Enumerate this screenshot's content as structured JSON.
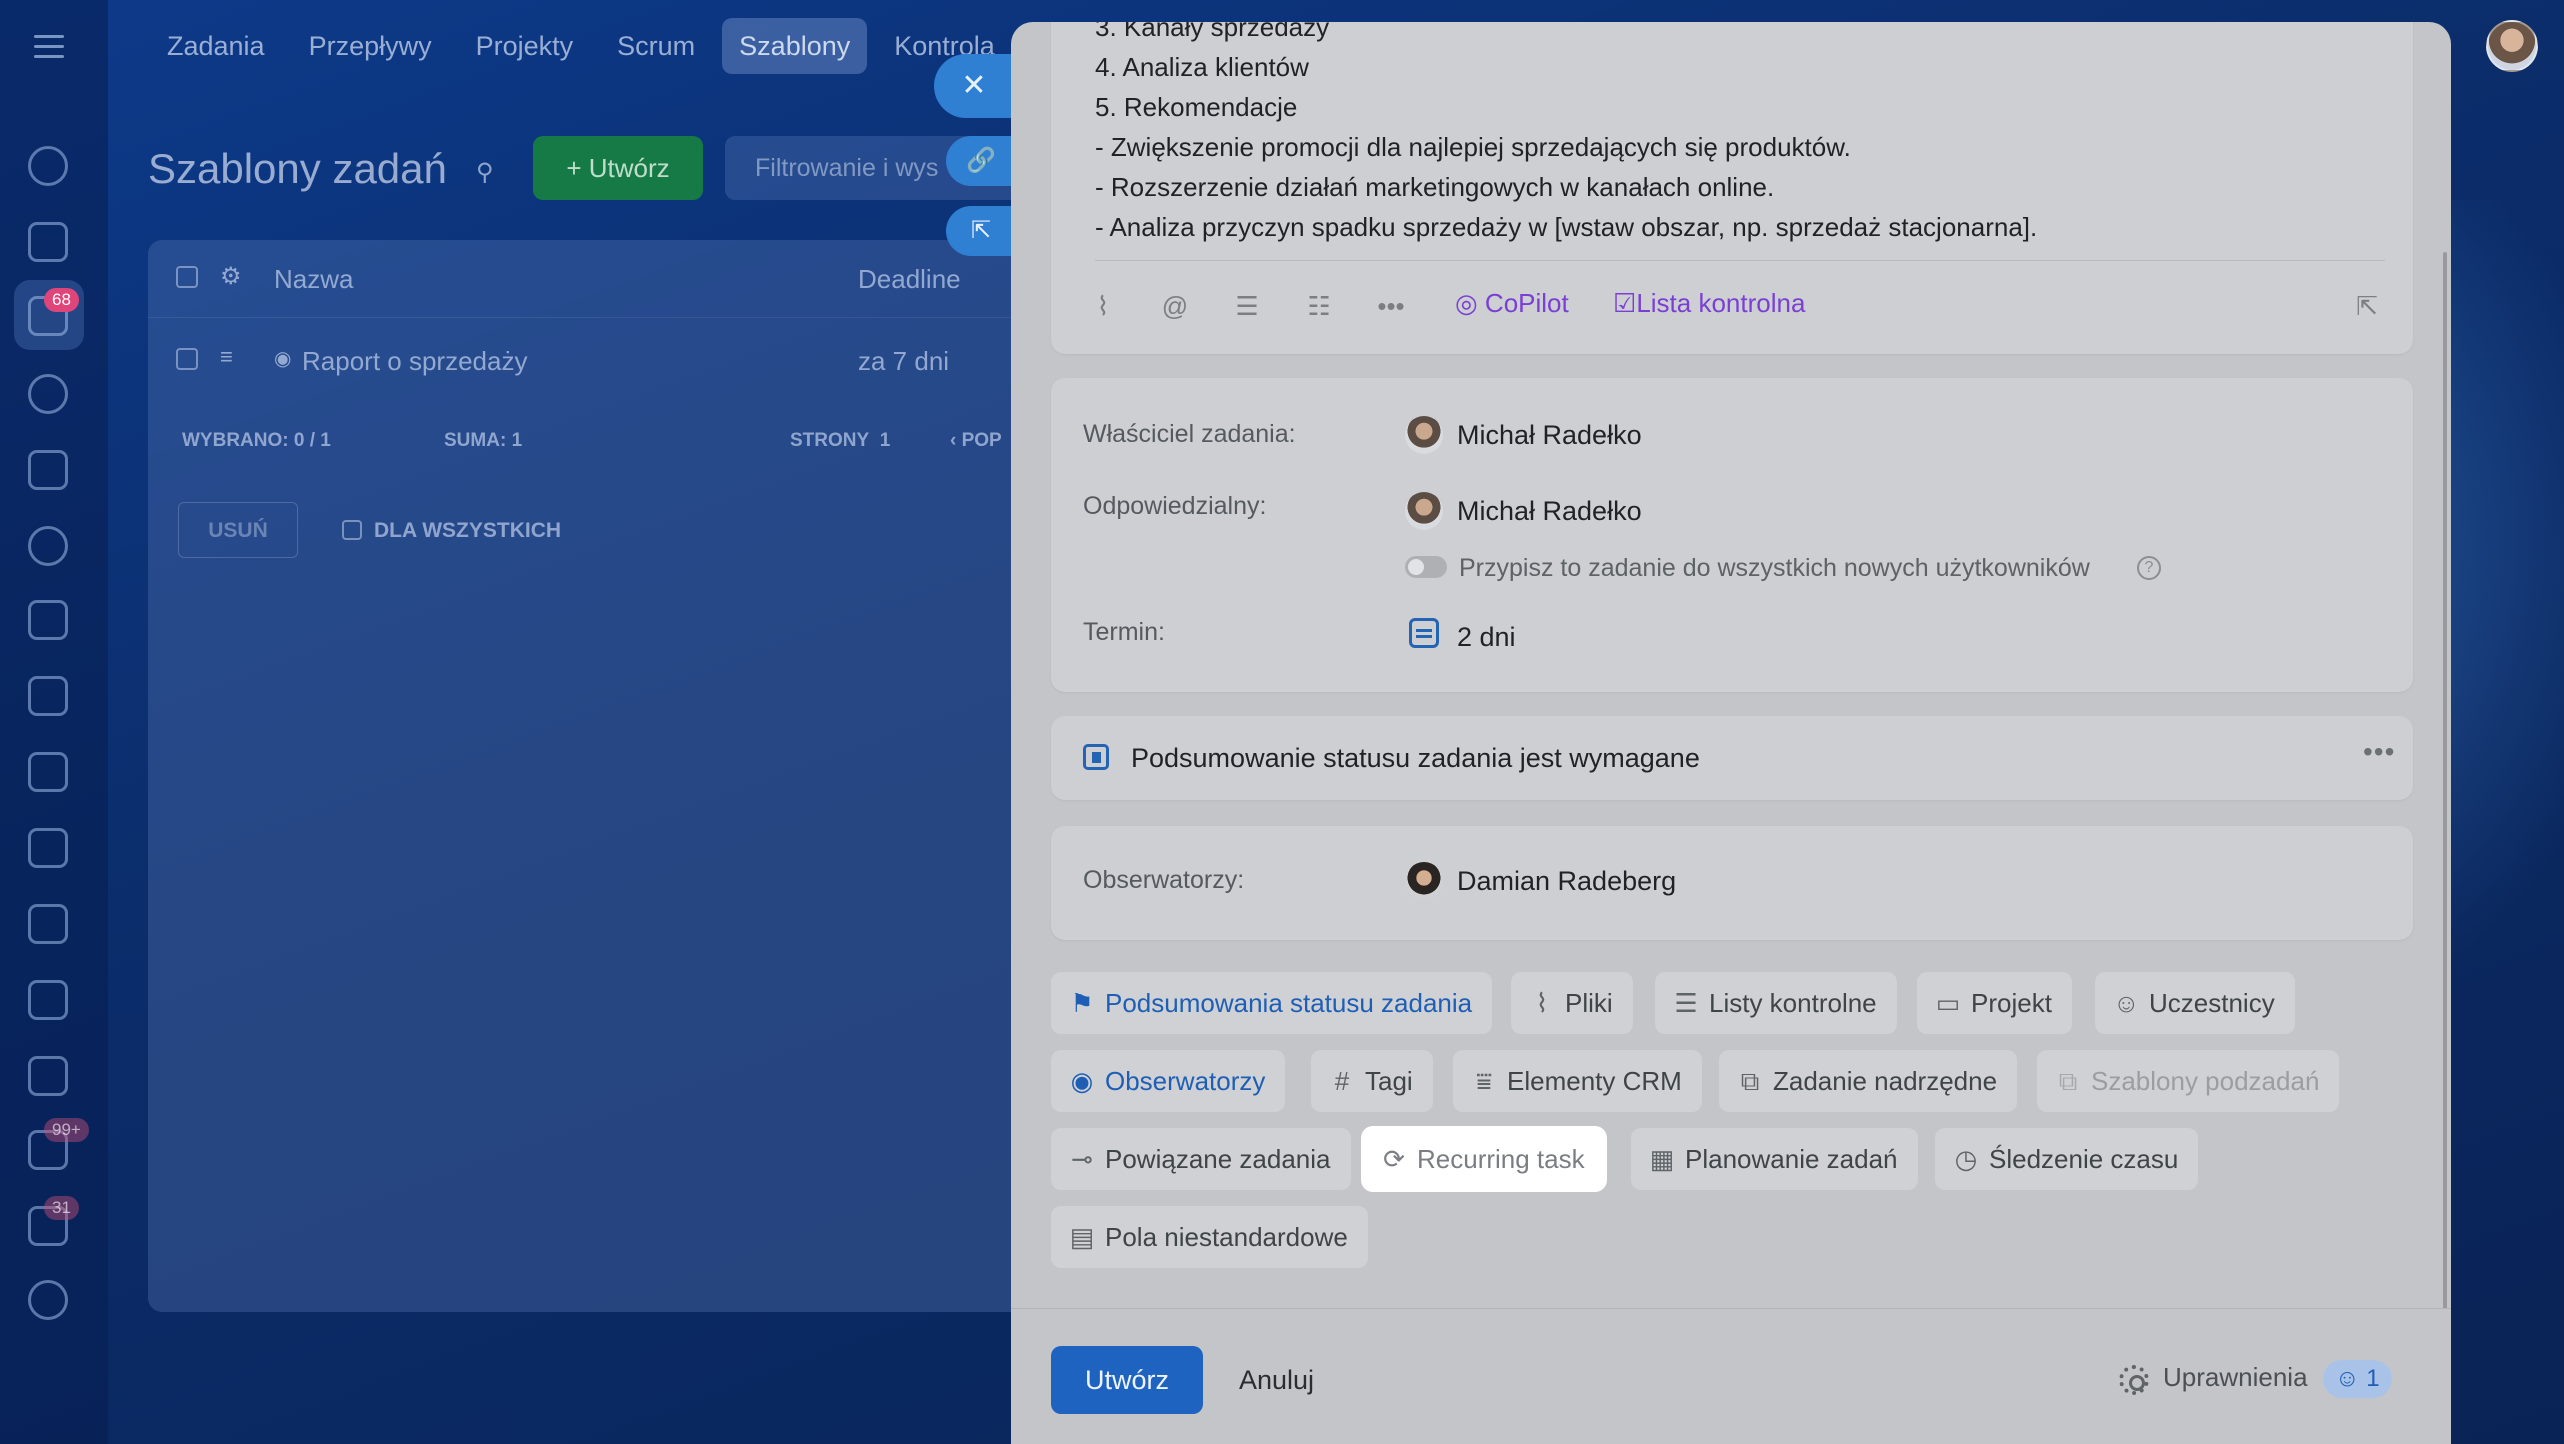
{
  "topnav": {
    "items": [
      "Zadania",
      "Przepływy",
      "Projekty",
      "Scrum",
      "Szablony",
      "Kontrola"
    ],
    "active_index": 4
  },
  "rail": {
    "badge_messages": "68",
    "badge_mail": "99+",
    "badge_other": "31"
  },
  "page": {
    "title": "Szablony zadań",
    "create_label": "+ Utwórz",
    "filter_placeholder": "Filtrowanie i wys"
  },
  "grid": {
    "columns": [
      "Nazwa",
      "Deadline"
    ],
    "rows": [
      {
        "name": "Raport o sprzedaży",
        "deadline": "za 7 dni"
      }
    ],
    "footer": {
      "selected_label": "WYBRANO:",
      "selected_value": "0 / 1",
      "sum_label": "SUMA:",
      "sum_value": "1",
      "pages_label": "STRONY",
      "pages_value": "1",
      "prev_label": "POP"
    },
    "delete_label": "USUŃ",
    "for_all_label": "DLA WSZYSTKICH"
  },
  "panel": {
    "description_lines": [
      "3. Kanały sprzedaży",
      "4. Analiza klientów",
      "5. Rekomendacje",
      "- Zwiększenie promocji dla najlepiej sprzedających się produktów.",
      "- Rozszerzenie działań marketingowych w kanałach online.",
      "- Analiza przyczyn spadku sprzedaży w [wstaw obszar, np. sprzedaż stacjonarna]."
    ],
    "toolbar": {
      "copilot_label": "CoPilot",
      "checklist_label": "Lista kontrolna"
    },
    "owner_label": "Właściciel zadania:",
    "owner_name": "Michał Radełko",
    "responsible_label": "Odpowiedzialny:",
    "responsible_name": "Michał Radełko",
    "assign_all_label": "Przypisz to zadanie do wszystkich nowych użytkowników",
    "term_label": "Termin:",
    "term_value": "2 dni",
    "summary_required_label": "Podsumowanie statusu zadania jest wymagane",
    "observers_label": "Obserwatorzy:",
    "observer_name": "Damian Radeberg",
    "chips": [
      {
        "label": "Podsumowania statusu zadania",
        "icon": "flag-icon",
        "state": "active"
      },
      {
        "label": "Pliki",
        "icon": "paperclip-icon",
        "state": "normal"
      },
      {
        "label": "Listy kontrolne",
        "icon": "checklist-icon",
        "state": "normal"
      },
      {
        "label": "Projekt",
        "icon": "folder-icon",
        "state": "normal"
      },
      {
        "label": "Uczestnicy",
        "icon": "person-icon",
        "state": "normal"
      },
      {
        "label": "Obserwatorzy",
        "icon": "eye-icon",
        "state": "active"
      },
      {
        "label": "Tagi",
        "icon": "hash-icon",
        "state": "normal"
      },
      {
        "label": "Elementy CRM",
        "icon": "crm-icon",
        "state": "normal"
      },
      {
        "label": "Zadanie nadrzędne",
        "icon": "parent-task-icon",
        "state": "normal"
      },
      {
        "label": "Szablony podzadań",
        "icon": "subtask-template-icon",
        "state": "disabled"
      },
      {
        "label": "Powiązane zadania",
        "icon": "link-icon",
        "state": "normal"
      },
      {
        "label": "Recurring task",
        "icon": "repeat-icon",
        "state": "highlighted"
      },
      {
        "label": "Planowanie zadań",
        "icon": "calendar-clock-icon",
        "state": "normal"
      },
      {
        "label": "Śledzenie czasu",
        "icon": "stopwatch-icon",
        "state": "normal"
      },
      {
        "label": "Pola niestandardowe",
        "icon": "custom-fields-icon",
        "state": "normal"
      }
    ],
    "footer": {
      "create_label": "Utwórz",
      "cancel_label": "Anuluj",
      "permissions_label": "Uprawnienia",
      "participants_count": "1"
    }
  },
  "colors": {
    "primary": "#1f63c1",
    "accent_purple": "#7a3fd4",
    "create_green": "#167a46"
  }
}
